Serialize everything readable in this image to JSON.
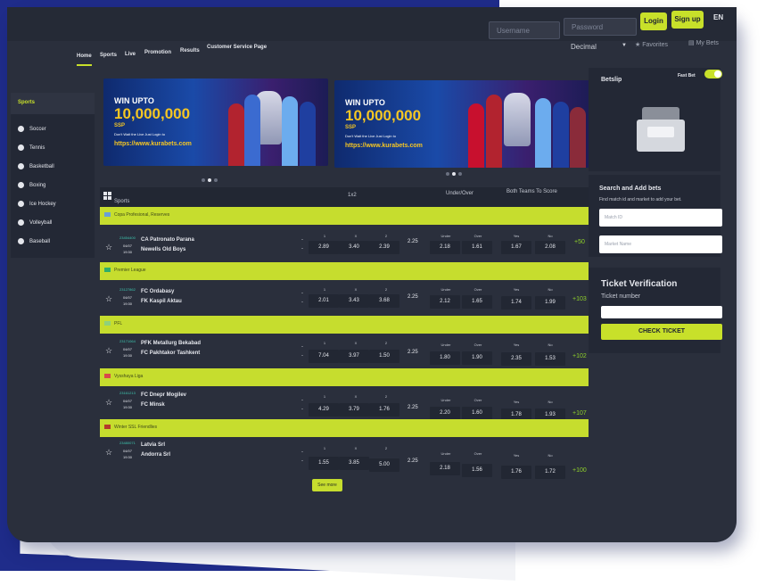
{
  "header": {
    "username_placeholder": "Username",
    "password_placeholder": "Password",
    "login_label": "Login",
    "signup_label": "Sign up",
    "language": "EN"
  },
  "nav": {
    "items": [
      "Home",
      "Sports",
      "Live",
      "Promotion",
      "Results",
      "Customer Service Page"
    ],
    "odds_format": "Decimal",
    "favorites_label": "Favorites",
    "mybets_label": "My Bets"
  },
  "sidebar": {
    "title": "Sports",
    "items": [
      "Soccer",
      "Tennis",
      "Basketball",
      "Boxing",
      "Ice Hockey",
      "Volleyball",
      "Baseball"
    ]
  },
  "banners": [
    {
      "line1": "WIN UPTO",
      "amount": "10,000,000",
      "currency": "SSP",
      "tagline": "Don't Wait the Live Just Login to",
      "url": "https://www.kurabets.com"
    },
    {
      "line1": "WIN UPTO",
      "amount": "10,000,000",
      "currency": "SSP",
      "tagline": "Don't Wait the Live Just Login to",
      "url": "https://www.kurabets.com"
    }
  ],
  "table": {
    "sports_label": "Sports",
    "col_1x2": "1x2",
    "col_under_over": "Under/Over",
    "col_btts": "Both Teams To Score",
    "see_more": "See more"
  },
  "leagues": [
    {
      "name": "Copa Profesional, Reserves",
      "id": "23454400",
      "date": "04/07",
      "time": "19:30",
      "home": "CA Patronato Parana",
      "away": "Newells Old Boys",
      "o1": "2.89",
      "ox": "3.40",
      "o2": "2.39",
      "line": "2.25",
      "under": "2.18",
      "over": "1.61",
      "yes": "1.67",
      "no": "2.08",
      "more": "+50"
    },
    {
      "name": "Premier League",
      "id": "23127862",
      "date": "04/07",
      "time": "19:30",
      "home": "FC Ordabasy",
      "away": "FK Kaspil Aktau",
      "o1": "2.01",
      "ox": "3.43",
      "o2": "3.68",
      "line": "2.25",
      "under": "2.12",
      "over": "1.65",
      "yes": "1.74",
      "no": "1.99",
      "more": "+103"
    },
    {
      "name": "PFL",
      "id": "23171064",
      "date": "04/07",
      "time": "19:30",
      "home": "PFK Metallurg Bekabad",
      "away": "FC Pakhtakor Tashkent",
      "o1": "7.04",
      "ox": "3.97",
      "o2": "1.50",
      "line": "2.25",
      "under": "1.80",
      "over": "1.90",
      "yes": "2.35",
      "no": "1.53",
      "more": "+102"
    },
    {
      "name": "Vysshaya Liga",
      "id": "23161213",
      "date": "04/07",
      "time": "19:30",
      "home": "FC Dnepr Mogilev",
      "away": "FC Minsk",
      "o1": "4.29",
      "ox": "3.79",
      "o2": "1.76",
      "line": "2.25",
      "under": "2.20",
      "over": "1.60",
      "yes": "1.78",
      "no": "1.93",
      "more": "+107"
    },
    {
      "name": "Winter SSL Friendlies",
      "id": "23480071",
      "date": "04/07",
      "time": "19:30",
      "home": "Latvia Srl",
      "away": "Andorra Srl",
      "o1": "1.55",
      "ox": "3.85",
      "o2": "5.00",
      "line": "2.25",
      "under": "2.18",
      "over": "1.56",
      "yes": "1.76",
      "no": "1.72",
      "more": "+100"
    }
  ],
  "odds_labels": {
    "one": "1",
    "x": "X",
    "two": "2",
    "under": "Under",
    "over": "Over",
    "yes": "Yes",
    "no": "No"
  },
  "betslip": {
    "title": "Betslip",
    "fast_bet": "Fast Bet",
    "search_title": "Search and Add bets",
    "search_sub": "Find match id and market to add your bet.",
    "match_id_placeholder": "Match ID",
    "market_placeholder": "Market Name",
    "ticket_title": "Ticket Verification",
    "ticket_number_label": "Ticket number",
    "check_label": "CHECK TICKET"
  }
}
